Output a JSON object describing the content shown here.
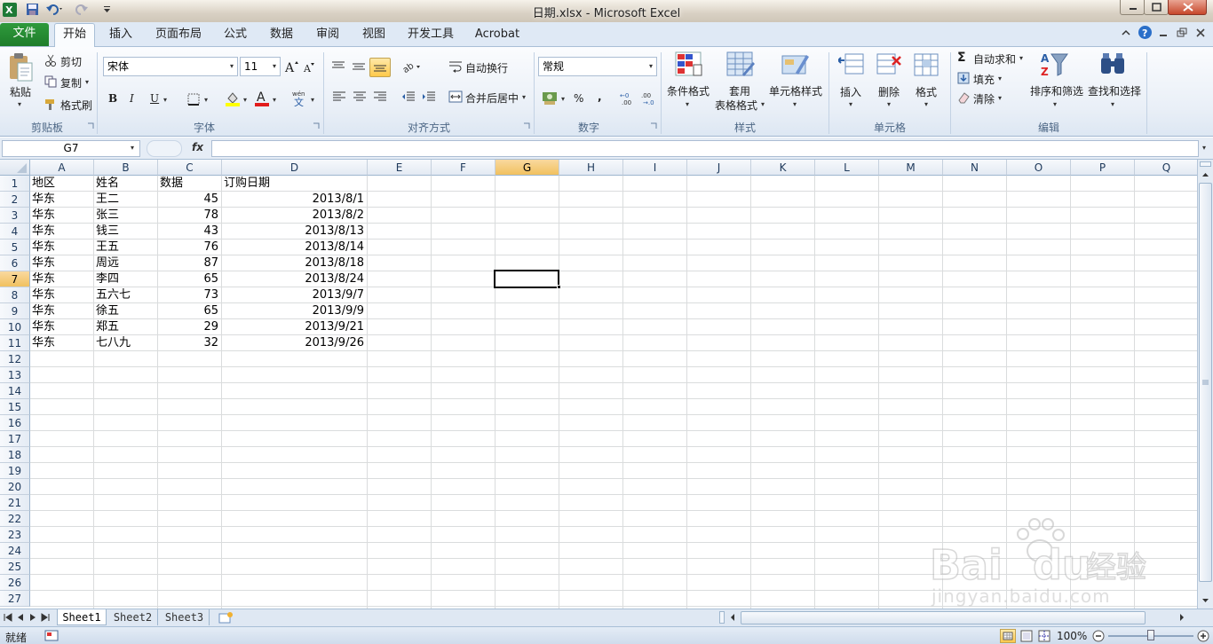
{
  "window": {
    "title": "日期.xlsx  -  Microsoft Excel"
  },
  "tabs": {
    "file": "文件",
    "home": "开始",
    "insert": "插入",
    "page_layout": "页面布局",
    "formulas": "公式",
    "data": "数据",
    "review": "审阅",
    "view": "视图",
    "developer": "开发工具",
    "acrobat": "Acrobat"
  },
  "ribbon": {
    "clipboard": {
      "paste": "粘贴",
      "cut": "剪切",
      "copy": "复制",
      "format_painter": "格式刷",
      "group": "剪贴板"
    },
    "font": {
      "name": "宋体",
      "size": "11",
      "group": "字体",
      "bold": "B",
      "italic": "I",
      "underline": "U"
    },
    "alignment": {
      "wrap_text": "自动换行",
      "merge_center": "合并后居中",
      "group": "对齐方式"
    },
    "number": {
      "format": "常规",
      "percent": "%",
      "comma": ",",
      "group": "数字"
    },
    "styles": {
      "conditional": "条件格式",
      "table_format_1": "套用",
      "table_format_2": "表格格式",
      "cell_styles": "单元格样式",
      "group": "样式"
    },
    "cells": {
      "insert": "插入",
      "delete": "删除",
      "format": "格式",
      "group": "单元格"
    },
    "editing": {
      "autosum": "自动求和",
      "fill": "填充",
      "clear": "清除",
      "sort_filter": "排序和筛选",
      "find_select": "查找和选择",
      "group": "编辑"
    }
  },
  "formula_bar": {
    "name_box": "G7",
    "fx": "fx",
    "formula": ""
  },
  "sheet": {
    "columns": [
      "A",
      "B",
      "C",
      "D",
      "E",
      "F",
      "G",
      "H",
      "I",
      "J",
      "K",
      "L",
      "M",
      "N",
      "O",
      "P",
      "Q"
    ],
    "rows": [
      "1",
      "2",
      "3",
      "4",
      "5",
      "6",
      "7",
      "8",
      "9",
      "10",
      "11",
      "12",
      "13",
      "14",
      "15",
      "16",
      "17",
      "18",
      "19",
      "20",
      "21",
      "22",
      "23",
      "24",
      "25",
      "26",
      "27"
    ],
    "selected_cell": "G7",
    "headers": [
      "地区",
      "姓名",
      "数据",
      "订购日期"
    ],
    "data": [
      [
        "华东",
        "王二",
        "45",
        "2013/8/1"
      ],
      [
        "华东",
        "张三",
        "78",
        "2013/8/2"
      ],
      [
        "华东",
        "钱三",
        "43",
        "2013/8/13"
      ],
      [
        "华东",
        "王五",
        "76",
        "2013/8/14"
      ],
      [
        "华东",
        "周远",
        "87",
        "2013/8/18"
      ],
      [
        "华东",
        "李四",
        "65",
        "2013/8/24"
      ],
      [
        "华东",
        "五六七",
        "73",
        "2013/9/7"
      ],
      [
        "华东",
        "徐五",
        "65",
        "2013/9/9"
      ],
      [
        "华东",
        "郑五",
        "29",
        "2013/9/21"
      ],
      [
        "华东",
        "七八九",
        "32",
        "2013/9/26"
      ]
    ]
  },
  "sheet_tabs": [
    "Sheet1",
    "Sheet2",
    "Sheet3"
  ],
  "status": {
    "ready": "就绪",
    "zoom": "100%"
  },
  "watermark": {
    "brand": "Bai",
    "brand2": "du",
    "cn": "经验",
    "url": "jingyan.baidu.com"
  }
}
